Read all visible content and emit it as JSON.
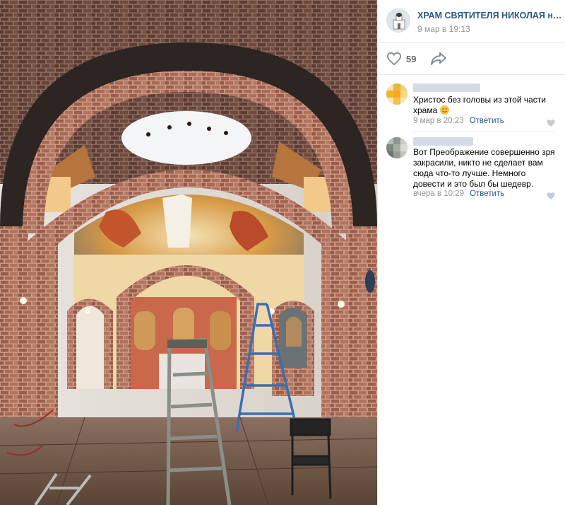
{
  "post": {
    "author": "ХРАМ СВЯТИТЕЛЯ НИКОЛАЯ на Ар…",
    "time": "9 мар в 19:13",
    "likes": "59"
  },
  "comments": [
    {
      "text": "Христос без головы из этой части храма",
      "time": "9 мар в 20:23",
      "reply_label": "Ответить"
    },
    {
      "text": "Вот Преображение совершенно зря закрасили, никто не сделает вам сюда что-то лучше. Немного довести и это был бы шедевр.",
      "time": "вчера в 10:29",
      "reply_label": "Ответить"
    }
  ],
  "icons": {
    "like": "heart-outline-icon",
    "share": "share-arrow-icon",
    "comment_like": "small-heart-icon",
    "emoji": "smile-emoji-icon"
  },
  "colors": {
    "link": "#2a5885",
    "meta": "#939393",
    "brick": "#a86a55"
  }
}
